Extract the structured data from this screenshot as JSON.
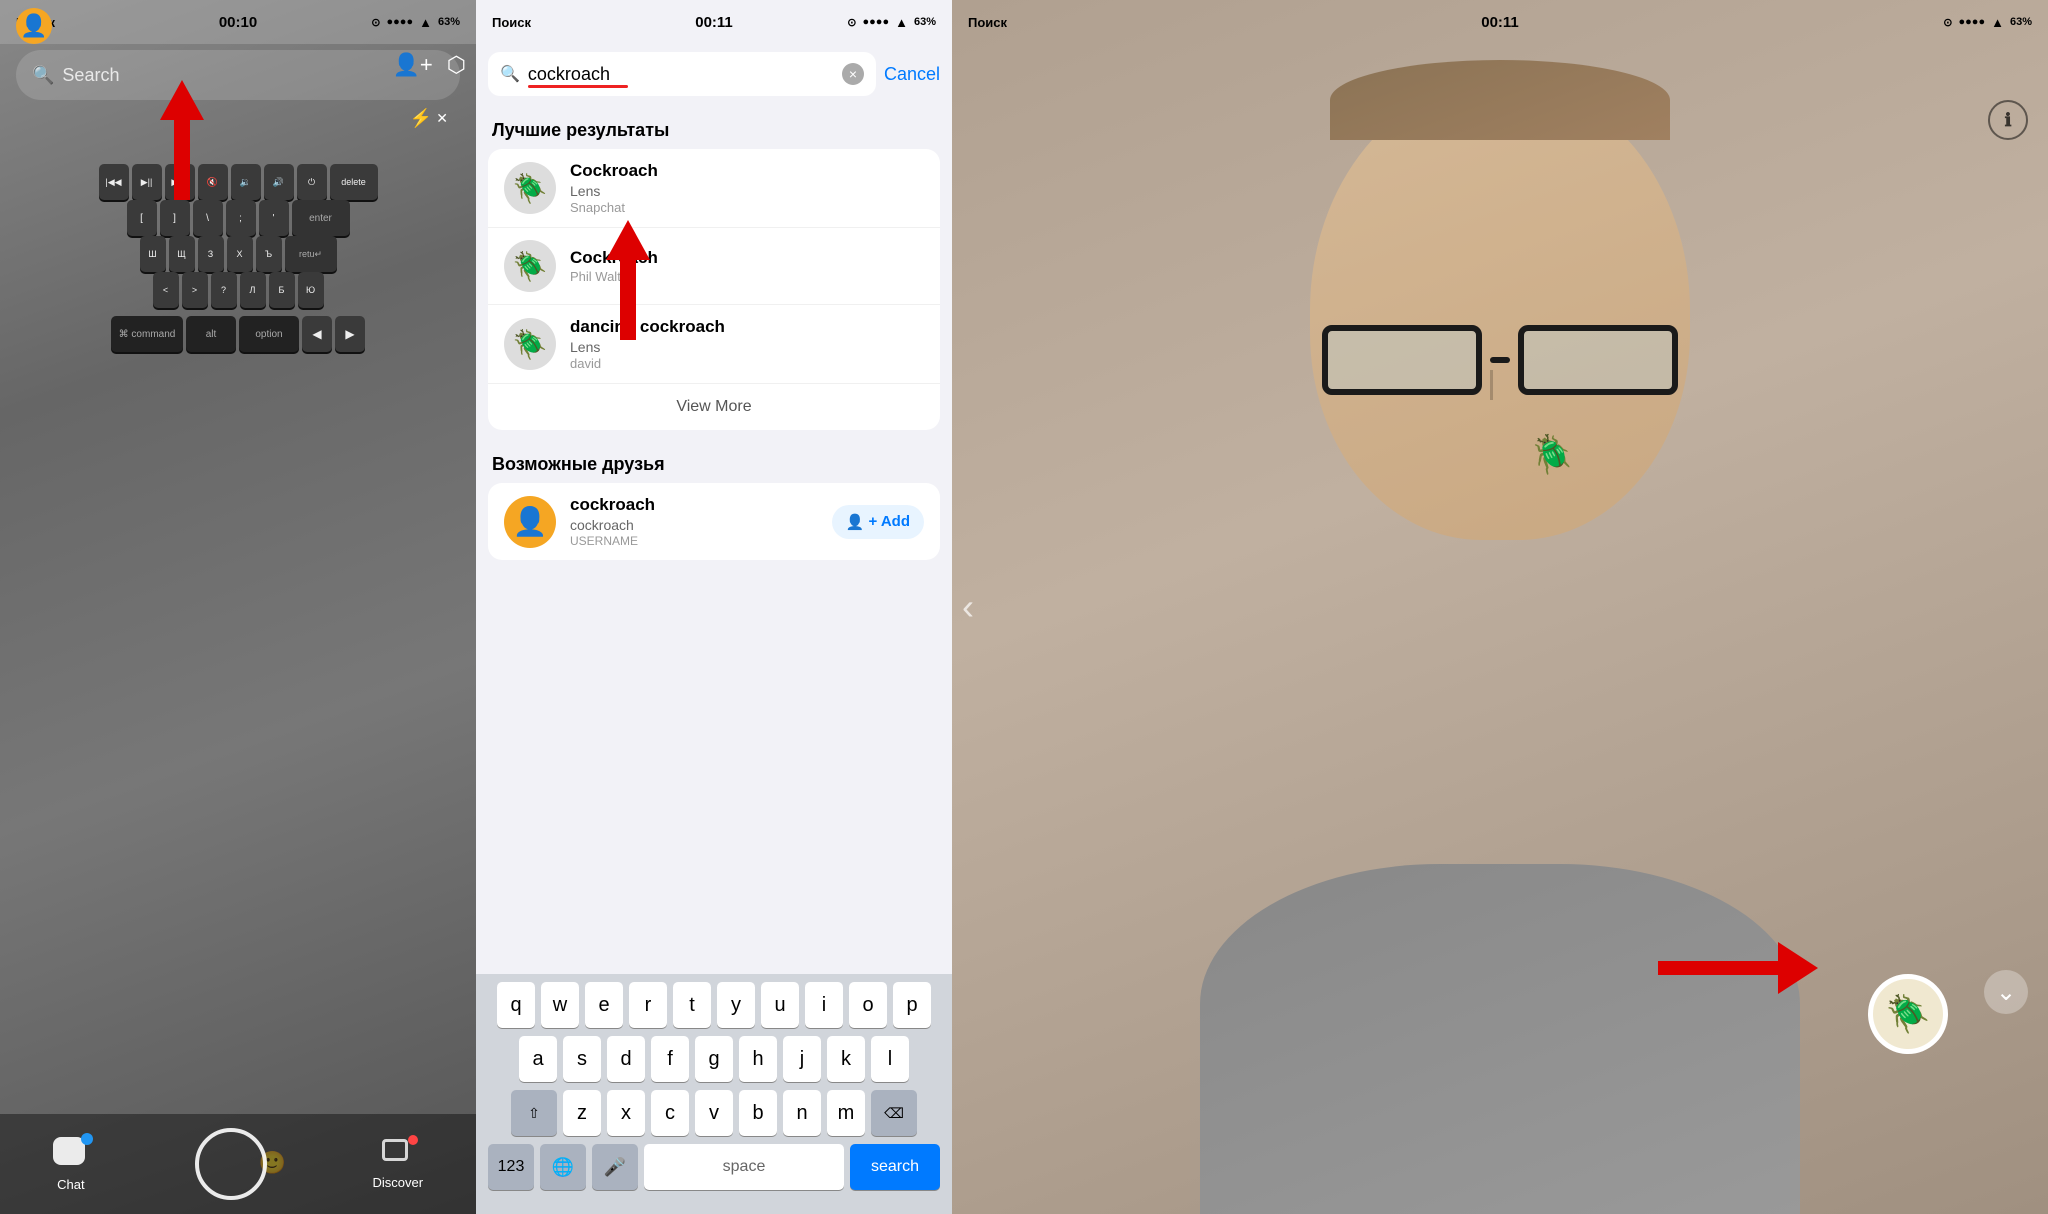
{
  "panel_left": {
    "status": {
      "carrier": "Поиск",
      "signal": "●●●●",
      "time": "00:10",
      "battery": "63%"
    },
    "search_placeholder": "Search",
    "bottom_nav": {
      "chat_label": "Chat",
      "discover_label": "Discover"
    }
  },
  "panel_middle": {
    "status": {
      "carrier": "Поиск",
      "signal": "●●●●",
      "time": "00:11",
      "battery": "63%"
    },
    "search_query": "cockroach",
    "cancel_label": "Cancel",
    "clear_label": "×",
    "best_results_header": "Лучшие результаты",
    "results": [
      {
        "name": "Cockroach",
        "sub": "Lens",
        "source": "Snapchat"
      },
      {
        "name": "Cockroach",
        "sub": "",
        "source": "Phil Walton"
      },
      {
        "name": "dancing cockroach",
        "sub": "Lens",
        "source": "david"
      }
    ],
    "view_more_label": "View More",
    "friends_header": "Возможные друзья",
    "friend": {
      "name": "cockroach",
      "username": "cockroach",
      "tag": "USERNAME",
      "add_label": "+ Add"
    },
    "keyboard": {
      "rows": [
        [
          "q",
          "w",
          "e",
          "r",
          "t",
          "y",
          "u",
          "i",
          "o",
          "p"
        ],
        [
          "a",
          "s",
          "d",
          "f",
          "g",
          "h",
          "j",
          "k",
          "l"
        ],
        [
          "z",
          "x",
          "c",
          "v",
          "b",
          "n",
          "m"
        ]
      ],
      "special_labels": {
        "shift": "⇧",
        "backspace": "⌫",
        "num": "123",
        "globe": "🌐",
        "mic": "🎤",
        "space": "space",
        "search": "search"
      }
    }
  },
  "panel_right": {
    "status": {
      "carrier": "Поиск",
      "signal": "●●●●",
      "time": "00:11",
      "battery": "63%"
    },
    "lens_icon": "🪲"
  }
}
